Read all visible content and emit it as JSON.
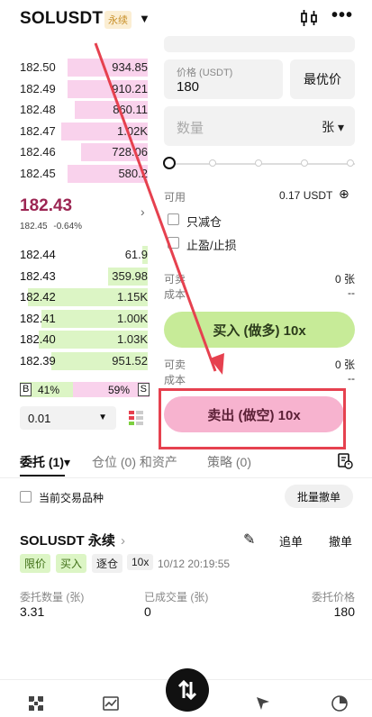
{
  "header": {
    "symbol": "SOLUSDT",
    "perp_tag": "永续",
    "caret": "▼",
    "more": "•••"
  },
  "orderbook": {
    "asks": [
      {
        "price": "182.50",
        "qty": "934.85",
        "depth": 0.6
      },
      {
        "price": "182.49",
        "qty": "910.21",
        "depth": 0.6
      },
      {
        "price": "182.48",
        "qty": "860.11",
        "depth": 0.55
      },
      {
        "price": "182.47",
        "qty": "1.02K",
        "depth": 0.65
      },
      {
        "price": "182.46",
        "qty": "728.06",
        "depth": 0.5
      },
      {
        "price": "182.45",
        "qty": "580.2",
        "depth": 0.6
      }
    ],
    "mid": {
      "price": "182.43",
      "mark": "182.45",
      "change": "-0.64%",
      "arrow": "›"
    },
    "bids": [
      {
        "price": "182.44",
        "qty": "61.9",
        "depth": 0.04
      },
      {
        "price": "182.43",
        "qty": "359.98",
        "depth": 0.3
      },
      {
        "price": "182.42",
        "qty": "1.15K",
        "depth": 0.9
      },
      {
        "price": "182.41",
        "qty": "1.00K",
        "depth": 0.8
      },
      {
        "price": "182.40",
        "qty": "1.03K",
        "depth": 0.82
      },
      {
        "price": "182.39",
        "qty": "951.52",
        "depth": 0.72
      }
    ],
    "ratio": {
      "buy_tag": "B",
      "buy_pct": "41%",
      "sell_pct": "59%",
      "sell_tag": "S",
      "buy_fraction": 0.41
    },
    "precision": "0.01",
    "precision_caret": "▼"
  },
  "form": {
    "price_label": "价格 (USDT)",
    "price_value": "180",
    "best_price": "最优价",
    "qty_placeholder": "数量",
    "qty_unit": "张 ▾",
    "available_label": "可用",
    "available_value": "0.17 USDT",
    "add_icon": "⊕",
    "reduce_only": "只减仓",
    "tp_sl": "止盈/止损",
    "buy_avail_label": "可卖",
    "buy_avail_value": "0 张",
    "buy_cost_label": "成本",
    "buy_cost_value": "--",
    "buy_button": "买入 (做多) 10x",
    "sell_avail_label": "可卖",
    "sell_avail_value": "0 张",
    "sell_cost_label": "成本",
    "sell_cost_value": "--",
    "sell_button": "卖出 (做空) 10x"
  },
  "tabs": {
    "orders": "委托 (1)▾",
    "positions": "仓位 (0) 和资产",
    "strategies": "策略 (0)"
  },
  "filter": {
    "current_symbol_only": "当前交易品种",
    "batch_cancel": "批量撤单"
  },
  "order": {
    "symbol": "SOLUSDT 永续",
    "symbol_arrow": "›",
    "edit_icon": "✎",
    "chase": "追单",
    "cancel": "撤单",
    "tags": [
      "限价",
      "买入",
      "逐仓",
      "10x"
    ],
    "time": "10/12 20:19:55",
    "qty_label": "委托数量 (张)",
    "qty_value": "3.31",
    "filled_label": "已成交量 (张)",
    "filled_value": "0",
    "price_label": "委托价格",
    "price_value": "180"
  }
}
